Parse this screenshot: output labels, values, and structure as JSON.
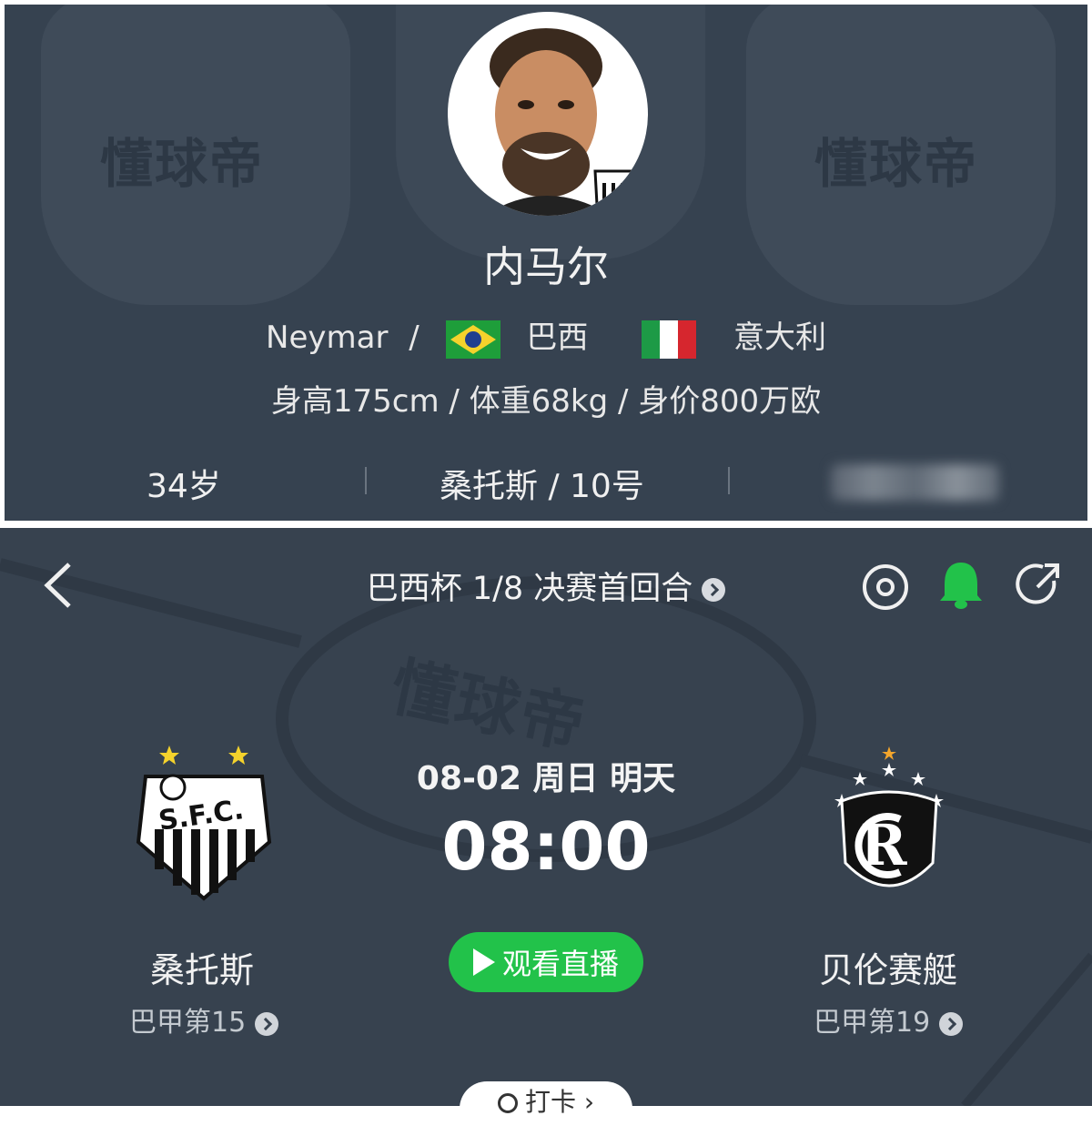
{
  "player": {
    "name_cn": "内马尔",
    "name_en": "Neymar",
    "nationality_sep": "/",
    "country_primary": "巴西",
    "country_secondary": "意大利",
    "measurements": "身高175cm / 体重68kg / 身价800万欧",
    "age": "34岁",
    "club_number": "桑托斯 / 10号",
    "watermark": "懂球帝"
  },
  "match": {
    "competition": "巴西杯 1/8 决赛首回合",
    "date": "08-02 周日 明天",
    "time": "08:00",
    "watch_label": "观看直播",
    "bottom_pill": "打卡",
    "home": {
      "name": "桑托斯",
      "rank": "巴甲第15"
    },
    "away": {
      "name": "贝伦赛艇",
      "rank": "巴甲第19"
    },
    "watermark": "懂球帝"
  },
  "icons": {
    "back": "chevron-left-icon",
    "target": "target-icon",
    "bell": "bell-icon",
    "share": "share-icon"
  },
  "colors": {
    "accent_green": "#22c24a",
    "bg_top": "#364250",
    "bg_bottom": "#37424f"
  }
}
